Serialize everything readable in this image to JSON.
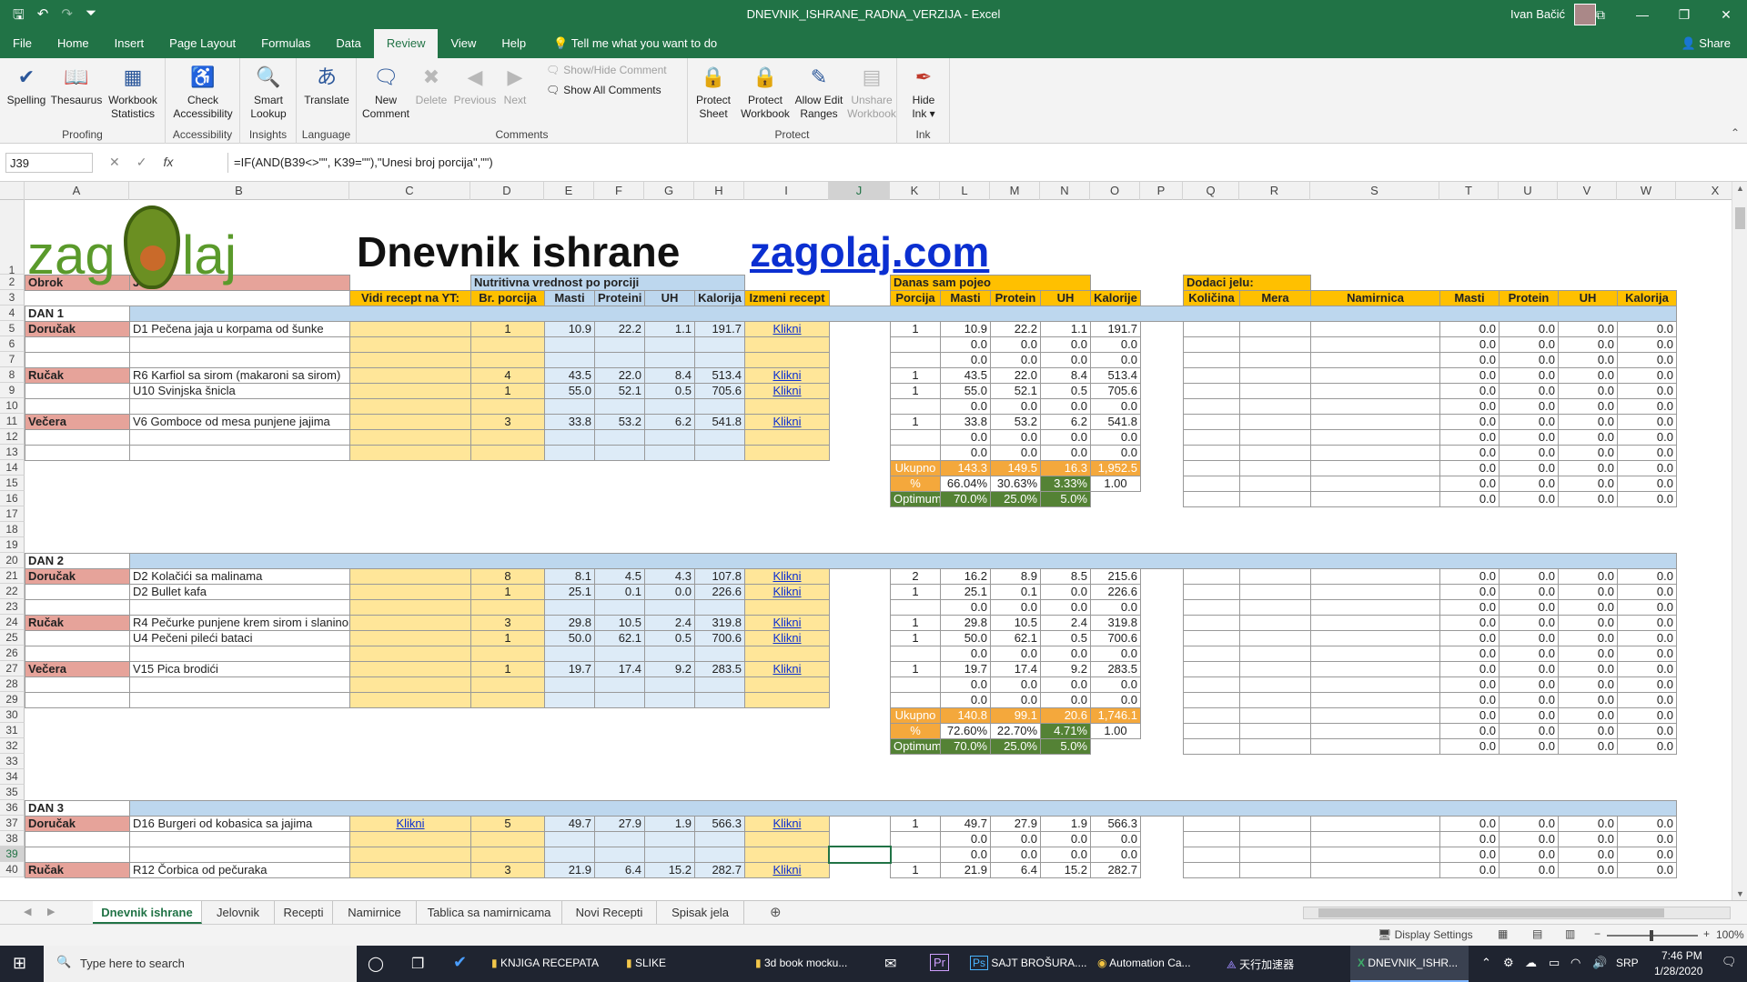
{
  "window": {
    "title": "DNEVNIK_ISHRANE_RADNA_VERZIJA  -  Excel",
    "user": "Ivan Bačić",
    "controls": [
      "⧉",
      "—",
      "❐",
      "✕"
    ]
  },
  "ribbon_tabs": [
    "File",
    "Home",
    "Insert",
    "Page Layout",
    "Formulas",
    "Data",
    "Review",
    "View",
    "Help"
  ],
  "active_tab": "Review",
  "tell_me": "Tell me what you want to do",
  "share": "Share",
  "ribbon": {
    "proofing": {
      "label": "Proofing",
      "spelling": "Spelling",
      "thesaurus": "Thesaurus",
      "workbook_stats_1": "Workbook",
      "workbook_stats_2": "Statistics"
    },
    "accessibility": {
      "label": "Accessibility",
      "check_1": "Check",
      "check_2": "Accessibility"
    },
    "insights": {
      "label": "Insights",
      "smart_1": "Smart",
      "smart_2": "Lookup"
    },
    "language": {
      "label": "Language",
      "translate": "Translate"
    },
    "comments": {
      "label": "Comments",
      "new_1": "New",
      "new_2": "Comment",
      "delete": "Delete",
      "previous": "Previous",
      "next": "Next",
      "show_hide": "Show/Hide Comment",
      "show_all": "Show All Comments"
    },
    "protect": {
      "label": "Protect",
      "sheet_1": "Protect",
      "sheet_2": "Sheet",
      "wb_1": "Protect",
      "wb_2": "Workbook",
      "edit_1": "Allow Edit",
      "edit_2": "Ranges",
      "unshare_1": "Unshare",
      "unshare_2": "Workbook"
    },
    "ink": {
      "label": "Ink",
      "hide_1": "Hide",
      "hide_2": "Ink ▾"
    }
  },
  "formula_bar": {
    "name_box": "J39",
    "formula": "=IF(AND(B39<>\"\", K39=\"\"),\"Unesi broj porcija\",\"\")"
  },
  "columns": [
    "A",
    "B",
    "C",
    "D",
    "E",
    "F",
    "G",
    "H",
    "I",
    "J",
    "K",
    "L",
    "M",
    "N",
    "O",
    "P",
    "Q",
    "R",
    "S",
    "T",
    "U",
    "V",
    "W",
    "X"
  ],
  "rows": [
    "1",
    "2",
    "3",
    "4",
    "5",
    "6",
    "7",
    "8",
    "9",
    "10",
    "11",
    "12",
    "13",
    "14",
    "15",
    "16",
    "17",
    "18",
    "19",
    "20",
    "21",
    "22",
    "23",
    "24",
    "25",
    "26",
    "27",
    "28",
    "29",
    "30",
    "31",
    "32",
    "33",
    "34",
    "35",
    "36",
    "37",
    "38",
    "39",
    "40"
  ],
  "header": {
    "logo": {
      "a": "zag",
      "b": "laj"
    },
    "title": "Dnevnik ishrane",
    "link": "zagolaj.com",
    "obrok": "Obrok",
    "jelo": "Jelo",
    "nutritivna": "Nutritivna vrednost po porciji",
    "vidi": "Vidi recept na YT:",
    "br_porcija": "Br. porcija",
    "masti": "Masti",
    "proteini": "Proteini",
    "uh": "UH",
    "kalorija": "Kalorija",
    "izmeni": "Izmeni recept",
    "danas": "Danas sam pojeo",
    "porcija": "Porcija",
    "protein": "Protein",
    "kalorije": "Kalorije",
    "dodaci": "Dodaci jelu:",
    "kolicina": "Količina",
    "mera": "Mera",
    "namirnica": "Namirnica"
  },
  "days": [
    {
      "label": "DAN 1",
      "rows": [
        {
          "obrok": "Doručak",
          "jelo": "D1 Pečena jaja u korpama od šunke",
          "yt": "",
          "br": "1",
          "m": "10.9",
          "p": "22.2",
          "uh": "1.1",
          "k": "191.7",
          "link": "Klikni",
          "por": "1",
          "dm": "10.9",
          "dp": "22.2",
          "duh": "1.1",
          "dk": "191.7"
        },
        {
          "obrok": "",
          "jelo": "",
          "yt": "",
          "br": "",
          "m": "",
          "p": "",
          "uh": "",
          "k": "",
          "link": "",
          "por": "",
          "dm": "0.0",
          "dp": "0.0",
          "duh": "0.0",
          "dk": "0.0"
        },
        {
          "obrok": "",
          "jelo": "",
          "yt": "",
          "br": "",
          "m": "",
          "p": "",
          "uh": "",
          "k": "",
          "link": "",
          "por": "",
          "dm": "0.0",
          "dp": "0.0",
          "duh": "0.0",
          "dk": "0.0"
        },
        {
          "obrok": "Ručak",
          "jelo": "R6 Karfiol sa sirom (makaroni sa sirom)",
          "yt": "",
          "br": "4",
          "m": "43.5",
          "p": "22.0",
          "uh": "8.4",
          "k": "513.4",
          "link": "Klikni",
          "por": "1",
          "dm": "43.5",
          "dp": "22.0",
          "duh": "8.4",
          "dk": "513.4"
        },
        {
          "obrok": "",
          "jelo": "U10 Svinjska šnicla",
          "yt": "",
          "br": "1",
          "m": "55.0",
          "p": "52.1",
          "uh": "0.5",
          "k": "705.6",
          "link": "Klikni",
          "por": "1",
          "dm": "55.0",
          "dp": "52.1",
          "duh": "0.5",
          "dk": "705.6"
        },
        {
          "obrok": "",
          "jelo": "",
          "yt": "",
          "br": "",
          "m": "",
          "p": "",
          "uh": "",
          "k": "",
          "link": "",
          "por": "",
          "dm": "0.0",
          "dp": "0.0",
          "duh": "0.0",
          "dk": "0.0"
        },
        {
          "obrok": "Večera",
          "jelo": "V6 Gomboce od mesa punjene jajima",
          "yt": "",
          "br": "3",
          "m": "33.8",
          "p": "53.2",
          "uh": "6.2",
          "k": "541.8",
          "link": "Klikni",
          "por": "1",
          "dm": "33.8",
          "dp": "53.2",
          "duh": "6.2",
          "dk": "541.8"
        },
        {
          "obrok": "",
          "jelo": "",
          "yt": "",
          "br": "",
          "m": "",
          "p": "",
          "uh": "",
          "k": "",
          "link": "",
          "por": "",
          "dm": "0.0",
          "dp": "0.0",
          "duh": "0.0",
          "dk": "0.0"
        },
        {
          "obrok": "",
          "jelo": "",
          "yt": "",
          "br": "",
          "m": "",
          "p": "",
          "uh": "",
          "k": "",
          "link": "",
          "por": "",
          "dm": "0.0",
          "dp": "0.0",
          "duh": "0.0",
          "dk": "0.0"
        }
      ],
      "ukupno": {
        "label": "Ukupno",
        "m": "143.3",
        "p": "149.5",
        "uh": "16.3",
        "k": "1,952.5"
      },
      "pct": {
        "label": "%",
        "m": "66.04%",
        "p": "30.63%",
        "uh": "3.33%",
        "k": "1.00"
      },
      "opt": {
        "label": "Optimum",
        "m": "70.0%",
        "p": "25.0%",
        "uh": "5.0%"
      }
    },
    {
      "label": "DAN 2",
      "rows": [
        {
          "obrok": "Doručak",
          "jelo": "D2 Kolačići sa malinama",
          "yt": "",
          "br": "8",
          "m": "8.1",
          "p": "4.5",
          "uh": "4.3",
          "k": "107.8",
          "link": "Klikni",
          "por": "2",
          "dm": "16.2",
          "dp": "8.9",
          "duh": "8.5",
          "dk": "215.6"
        },
        {
          "obrok": "",
          "jelo": "D2 Bullet kafa",
          "yt": "",
          "br": "1",
          "m": "25.1",
          "p": "0.1",
          "uh": "0.0",
          "k": "226.6",
          "link": "Klikni",
          "por": "1",
          "dm": "25.1",
          "dp": "0.1",
          "duh": "0.0",
          "dk": "226.6"
        },
        {
          "obrok": "",
          "jelo": "",
          "yt": "",
          "br": "",
          "m": "",
          "p": "",
          "uh": "",
          "k": "",
          "link": "",
          "por": "",
          "dm": "0.0",
          "dp": "0.0",
          "duh": "0.0",
          "dk": "0.0"
        },
        {
          "obrok": "Ručak",
          "jelo": "R4 Pečurke punjene krem sirom i slaninom",
          "yt": "",
          "br": "3",
          "m": "29.8",
          "p": "10.5",
          "uh": "2.4",
          "k": "319.8",
          "link": "Klikni",
          "por": "1",
          "dm": "29.8",
          "dp": "10.5",
          "duh": "2.4",
          "dk": "319.8"
        },
        {
          "obrok": "",
          "jelo": "U4 Pečeni pileći bataci",
          "yt": "",
          "br": "1",
          "m": "50.0",
          "p": "62.1",
          "uh": "0.5",
          "k": "700.6",
          "link": "Klikni",
          "por": "1",
          "dm": "50.0",
          "dp": "62.1",
          "duh": "0.5",
          "dk": "700.6"
        },
        {
          "obrok": "",
          "jelo": "",
          "yt": "",
          "br": "",
          "m": "",
          "p": "",
          "uh": "",
          "k": "",
          "link": "",
          "por": "",
          "dm": "0.0",
          "dp": "0.0",
          "duh": "0.0",
          "dk": "0.0"
        },
        {
          "obrok": "Večera",
          "jelo": "V15 Pica brodići",
          "yt": "",
          "br": "1",
          "m": "19.7",
          "p": "17.4",
          "uh": "9.2",
          "k": "283.5",
          "link": "Klikni",
          "por": "1",
          "dm": "19.7",
          "dp": "17.4",
          "duh": "9.2",
          "dk": "283.5"
        },
        {
          "obrok": "",
          "jelo": "",
          "yt": "",
          "br": "",
          "m": "",
          "p": "",
          "uh": "",
          "k": "",
          "link": "",
          "por": "",
          "dm": "0.0",
          "dp": "0.0",
          "duh": "0.0",
          "dk": "0.0"
        },
        {
          "obrok": "",
          "jelo": "",
          "yt": "",
          "br": "",
          "m": "",
          "p": "",
          "uh": "",
          "k": "",
          "link": "",
          "por": "",
          "dm": "0.0",
          "dp": "0.0",
          "duh": "0.0",
          "dk": "0.0"
        }
      ],
      "ukupno": {
        "label": "Ukupno",
        "m": "140.8",
        "p": "99.1",
        "uh": "20.6",
        "k": "1,746.1"
      },
      "pct": {
        "label": "%",
        "m": "72.60%",
        "p": "22.70%",
        "uh": "4.71%",
        "k": "1.00"
      },
      "opt": {
        "label": "Optimum",
        "m": "70.0%",
        "p": "25.0%",
        "uh": "5.0%"
      }
    },
    {
      "label": "DAN 3",
      "rows": [
        {
          "obrok": "Doručak",
          "jelo": "D16 Burgeri od kobasica sa jajima",
          "yt": "Klikni",
          "br": "5",
          "m": "49.7",
          "p": "27.9",
          "uh": "1.9",
          "k": "566.3",
          "link": "Klikni",
          "por": "1",
          "dm": "49.7",
          "dp": "27.9",
          "duh": "1.9",
          "dk": "566.3"
        },
        {
          "obrok": "",
          "jelo": "",
          "yt": "",
          "br": "",
          "m": "",
          "p": "",
          "uh": "",
          "k": "",
          "link": "",
          "por": "",
          "dm": "0.0",
          "dp": "0.0",
          "duh": "0.0",
          "dk": "0.0"
        },
        {
          "obrok": "",
          "jelo": "",
          "yt": "",
          "br": "",
          "m": "",
          "p": "",
          "uh": "",
          "k": "",
          "link": "",
          "por": "",
          "dm": "0.0",
          "dp": "0.0",
          "duh": "0.0",
          "dk": "0.0"
        },
        {
          "obrok": "Ručak",
          "jelo": "R12 Čorbica od pečuraka",
          "yt": "",
          "br": "3",
          "m": "21.9",
          "p": "6.4",
          "uh": "15.2",
          "k": "282.7",
          "link": "Klikni",
          "por": "1",
          "dm": "21.9",
          "dp": "6.4",
          "duh": "15.2",
          "dk": "282.7"
        }
      ]
    }
  ],
  "addon_zero": "0.0",
  "sheet_tabs": [
    "Dnevnik ishrane",
    "Jelovnik",
    "Recepti",
    "Namirnice",
    "Tablica sa namirnicama",
    "Novi Recepti",
    "Spisak jela"
  ],
  "active_sheet": "Dnevnik ishrane",
  "status": {
    "display_settings": "Display Settings",
    "zoom": "100%"
  },
  "taskbar": {
    "search": "Type here to search",
    "items": [
      "KNJIGA RECEPATA",
      "SLIKE",
      "3d book mocku...",
      "SAJT BROŠURA....",
      "Automation Ca...",
      "天行加速器",
      "DNEVNIK_ISHR..."
    ],
    "lang": "SRP",
    "time": "7:46 PM",
    "date": "1/28/2020"
  },
  "colors": {
    "excel_green": "#217346",
    "orange": "#ffc000",
    "light_orange": "#ffe699",
    "blue": "#bdd7ee",
    "light_blue": "#ddebf7",
    "salmon": "#e6a39a",
    "green_dark": "#548235",
    "orange_total": "#f4a83c"
  }
}
